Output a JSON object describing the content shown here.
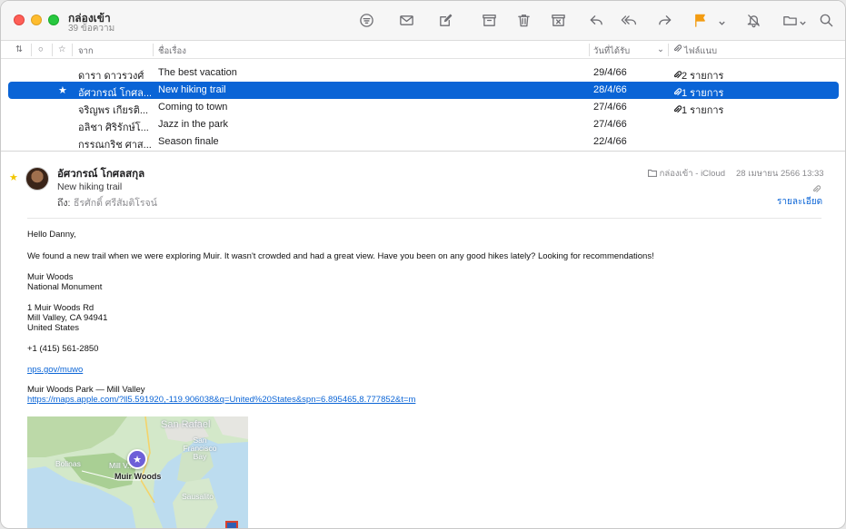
{
  "toolbar": {
    "mailbox_title": "กล่องเข้า",
    "message_count": "39 ข้อความ",
    "icons": [
      "filter-icon",
      "envelope-icon",
      "compose-icon",
      "archive-icon",
      "trash-icon",
      "junk-icon",
      "reply-icon",
      "reply-all-icon",
      "forward-icon",
      "flag-icon",
      "mute-bell-icon",
      "move-folder-icon",
      "search-icon"
    ],
    "flag_color": "#f39c12"
  },
  "columns": {
    "from": "จาก",
    "subject": "ชื่อเรื่อง",
    "received": "วันที่ได้รับ",
    "attachments": "ไฟล์แนบ"
  },
  "messages": [
    {
      "from": "ดารา ดาวรวงศ์",
      "subject": "The best vacation",
      "date": "29/4/66",
      "attachments": "2 รายการ",
      "starred": false,
      "selected": false
    },
    {
      "from": "อัศวกรณ์ โกศล...",
      "subject": "New hiking trail",
      "date": "28/4/66",
      "attachments": "1 รายการ",
      "starred": true,
      "selected": true
    },
    {
      "from": "จริญพร เกียรติ...",
      "subject": "Coming to town",
      "date": "27/4/66",
      "attachments": "1 รายการ",
      "starred": false,
      "selected": false
    },
    {
      "from": "อลิชา ศิริรักษ์โ...",
      "subject": "Jazz in the park",
      "date": "27/4/66",
      "attachments": "",
      "starred": false,
      "selected": false
    },
    {
      "from": "กรรณกริช ศาส...",
      "subject": "Season finale",
      "date": "22/4/66",
      "attachments": "",
      "starred": false,
      "selected": false
    }
  ],
  "message": {
    "sender": "อัศวกรณ์ โกศลสกุล",
    "subject": "New hiking trail",
    "to_label": "ถึง:",
    "to_name": "ธีรศักดิ์ ศรีสัมติโรจน์",
    "mailbox": "กล่องเข้า - iCloud",
    "date": "28 เมษายน 2566 13:33",
    "details_link": "รายละเอียด",
    "body": {
      "greeting": "Hello Danny,",
      "paragraph": "We found a new trail when we were exploring Muir. It wasn't crowded and had a great view. Have you been on any good hikes lately? Looking for recommendations!",
      "place1": "Muir Woods",
      "place2": "National Monument",
      "addr1": "1 Muir Woods Rd",
      "addr2": "Mill Valley, CA 94941",
      "addr3": "United States",
      "phone": "+1 (415) 561-2850",
      "website": "nps.gov/muwo",
      "maps_title": "Muir Woods Park — Mill Valley",
      "maps_url": "https://maps.apple.com/?ll5.591920,-119.906038&q=United%20States&spn=6.895465,8.777852&t=m"
    },
    "map": {
      "labels": {
        "san_rafael": "San Rafael",
        "san_francisco_bay": "San Francisco Bay",
        "bolinas": "Bolinas",
        "mill_valley": "Mill V...",
        "muir_woods": "Muir Woods",
        "sausalito": "Sausalito"
      }
    }
  }
}
